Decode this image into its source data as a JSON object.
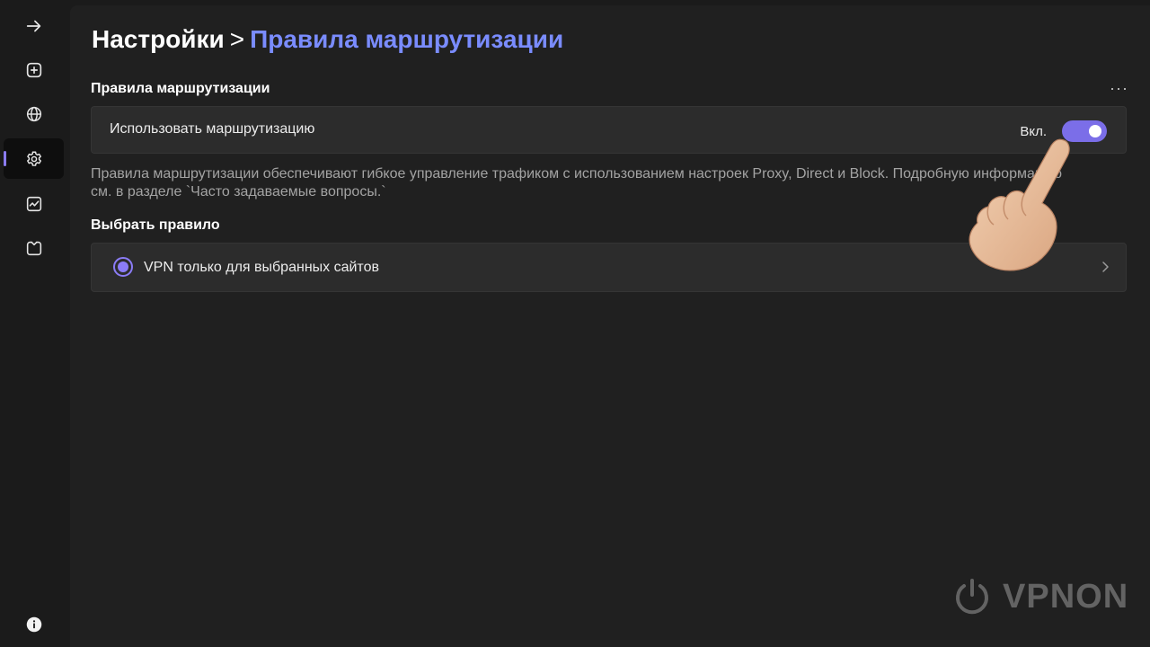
{
  "sidebar": {
    "items": [
      {
        "name": "arrow-right-icon"
      },
      {
        "name": "add-square-icon"
      },
      {
        "name": "globe-icon"
      },
      {
        "name": "gear-icon",
        "active": true
      },
      {
        "name": "activity-chart-icon"
      },
      {
        "name": "clipboard-icon"
      },
      {
        "name": "info-icon"
      }
    ]
  },
  "header": {
    "breadcrumb_root": "Настройки",
    "separator": ">",
    "breadcrumb_current": "Правила маршрутизации"
  },
  "routing": {
    "section_title": "Правила маршрутизации",
    "more_label": "···",
    "use_routing_label": "Использовать маршрутизацию",
    "toggle_state_label": "Вкл.",
    "toggle_on": true,
    "description": "Правила маршрутизации обеспечивают гибкое управление трафиком с использованием настроек Proxy, Direct и Block. Подробную информацию см. в разделе `Часто задаваемые вопросы.`"
  },
  "rule": {
    "section_title": "Выбрать правило",
    "selected_rule": "VPN только для выбранных сайтов"
  },
  "watermark": {
    "brand": "VPNON"
  },
  "colors": {
    "accent": "#8b7cf6",
    "breadcrumb_current": "#7a8cff",
    "toggle": "#7b6ee8"
  }
}
